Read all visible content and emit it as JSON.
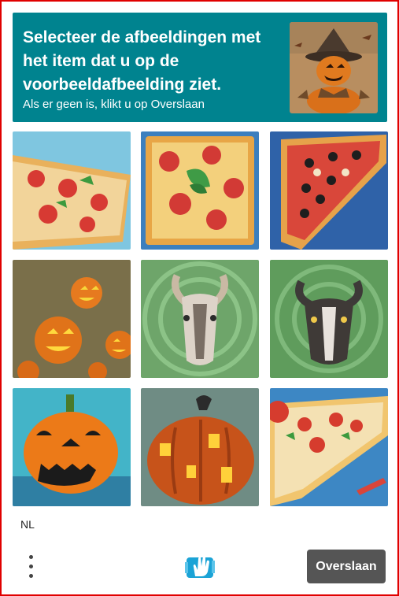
{
  "header": {
    "title": "Selecteer de afbeeldingen met het item dat u op de voorbeeldafbeelding ziet.",
    "subtitle": "Als er geen is, klikt u op Overslaan",
    "example_image": "scarecrow-pumpkin-head"
  },
  "grid": {
    "tiles": [
      {
        "subject": "pizza-slices"
      },
      {
        "subject": "pizza-with-basil"
      },
      {
        "subject": "pizza-slice-olives"
      },
      {
        "subject": "jack-o-lanterns-group"
      },
      {
        "subject": "goat-face"
      },
      {
        "subject": "goat-face-dark"
      },
      {
        "subject": "jack-o-lantern"
      },
      {
        "subject": "carved-pumpkin"
      },
      {
        "subject": "pizza-slice-painting"
      }
    ]
  },
  "footer": {
    "language": "NL",
    "menu_icon": "more-vertical-icon",
    "logo_icon": "hand-logo-icon",
    "skip_label": "Overslaan"
  },
  "colors": {
    "header_bg": "#00838f",
    "frame_border": "#e00000",
    "skip_bg": "#555555"
  }
}
